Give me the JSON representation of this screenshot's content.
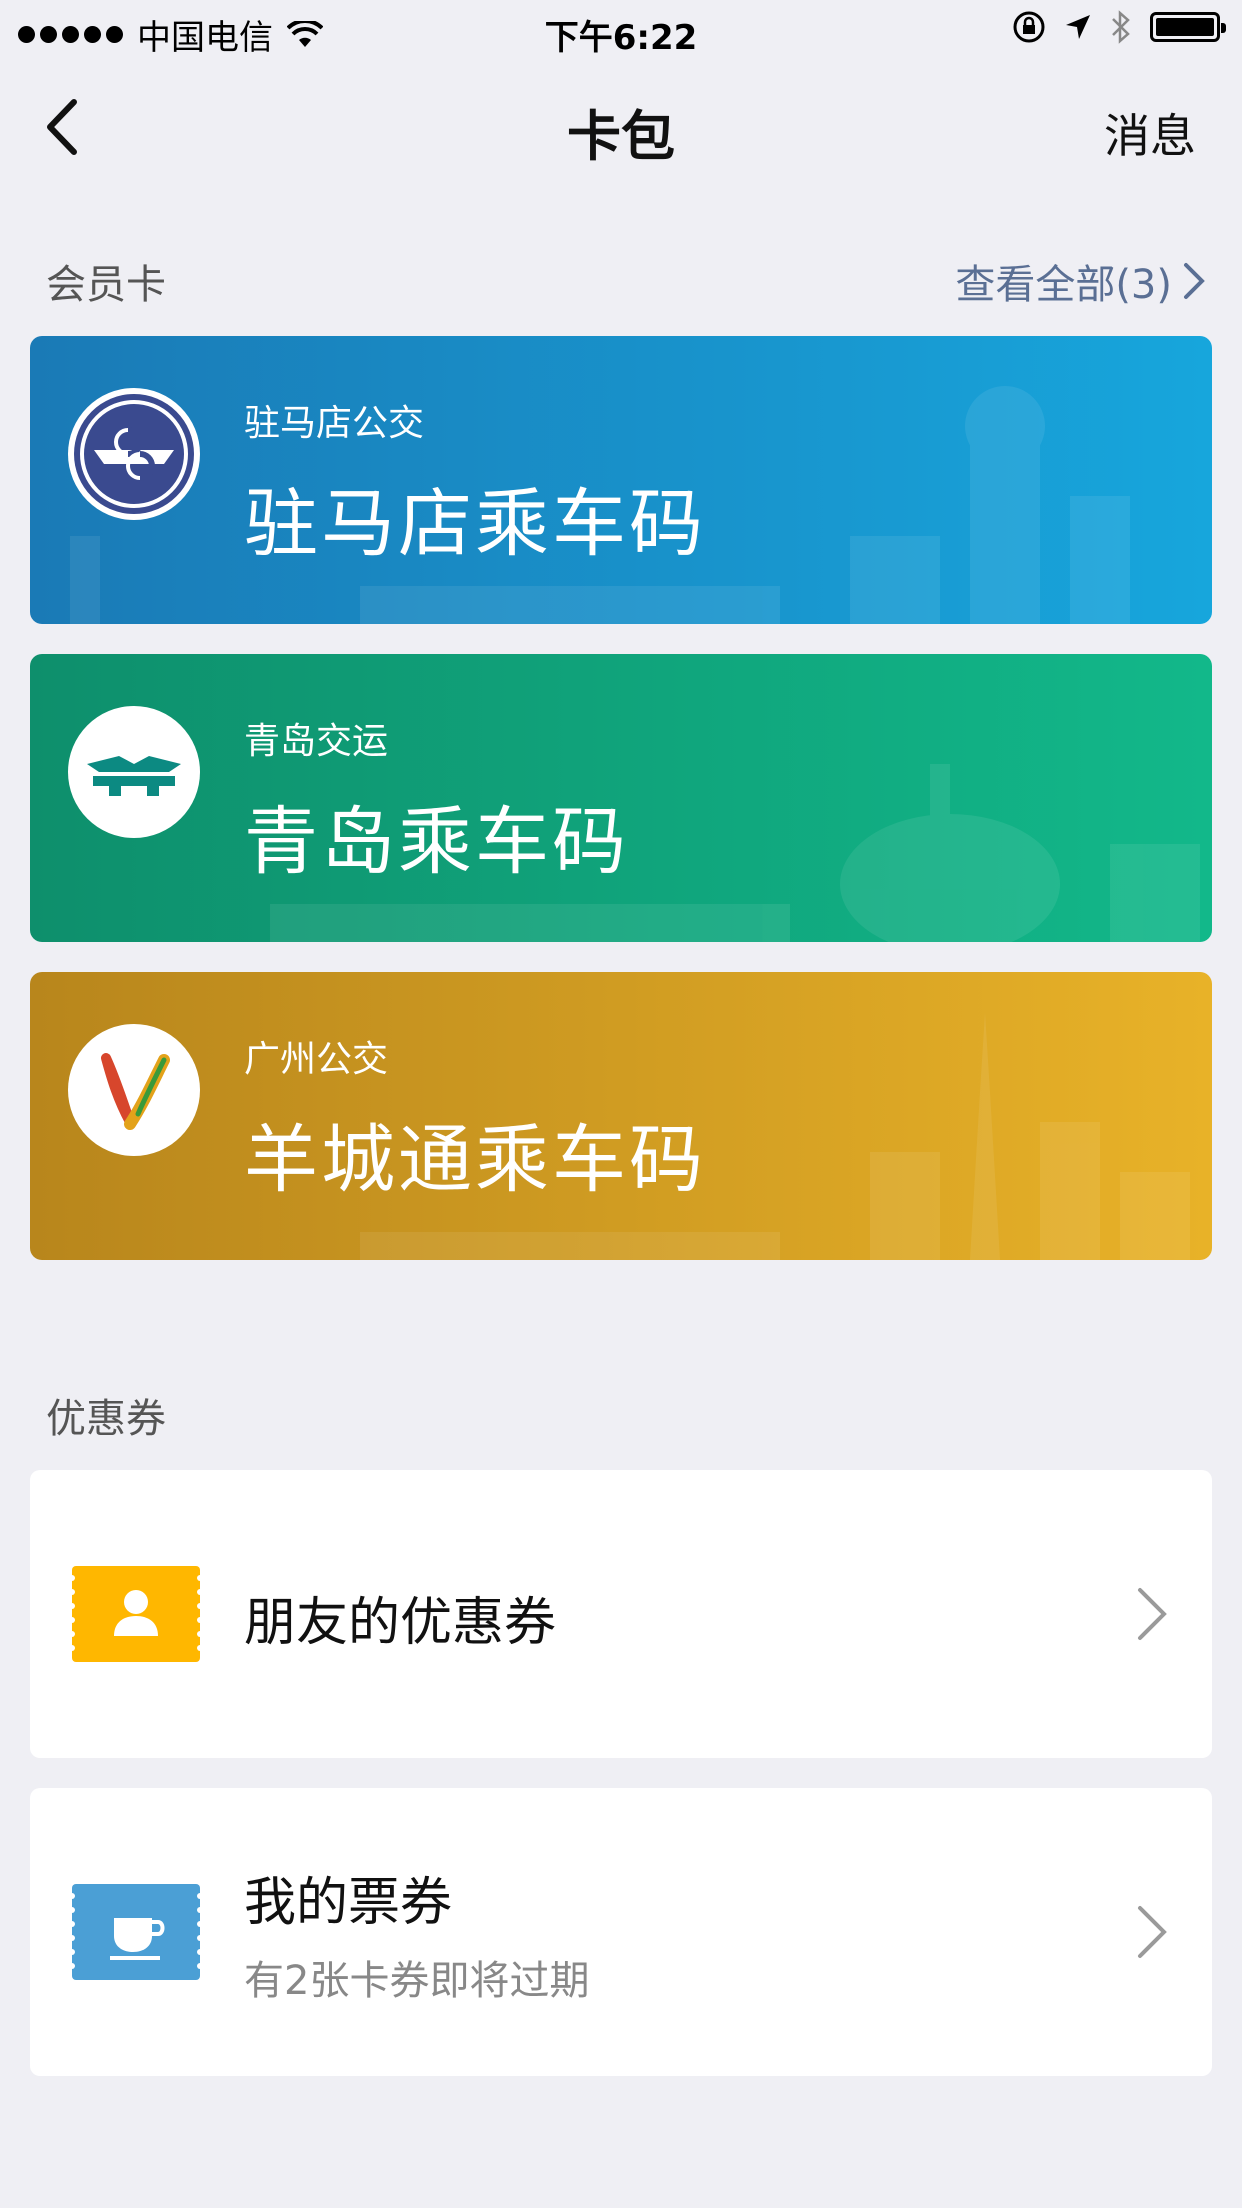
{
  "status_bar": {
    "carrier": "中国电信",
    "time": "下午6:22"
  },
  "nav": {
    "title": "卡包",
    "right_label": "消息"
  },
  "membership": {
    "section_label": "会员卡",
    "view_all": "查看全部(3)",
    "cards": [
      {
        "subtitle": "驻马店公交",
        "title": "驻马店乘车码",
        "color_from": "#1a7ab6",
        "color_to": "#17a6dc",
        "logo_icon": "zhumadian-bus-logo-icon"
      },
      {
        "subtitle": "青岛交运",
        "title": "青岛乘车码",
        "color_from": "#0e8f6c",
        "color_to": "#12b88a",
        "logo_icon": "qingdao-transit-logo-icon"
      },
      {
        "subtitle": "广州公交",
        "title": "羊城通乘车码",
        "color_from": "#b8861c",
        "color_to": "#e8b228",
        "logo_icon": "yangchengtong-logo-icon"
      }
    ]
  },
  "coupons": {
    "section_label": "优惠券",
    "items": [
      {
        "title": "朋友的优惠券",
        "subtitle": "",
        "icon": "friend-coupon-icon",
        "icon_color": "#ffb700"
      },
      {
        "title": "我的票券",
        "subtitle": "有2张卡券即将过期",
        "icon": "coffee-cup-icon",
        "icon_color": "#4b9fd5"
      }
    ]
  }
}
